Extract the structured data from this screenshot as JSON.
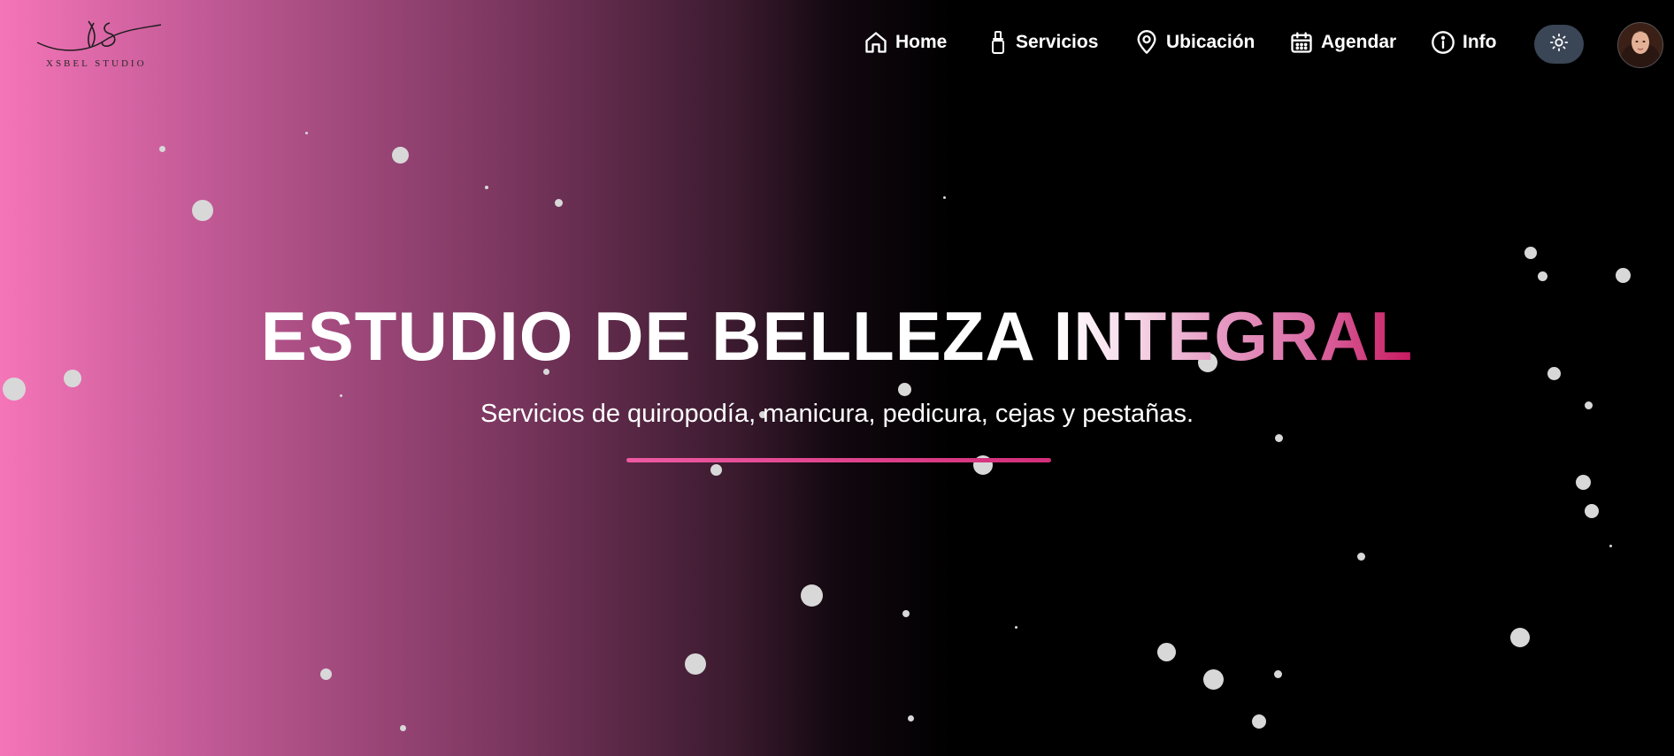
{
  "brand": {
    "logo_mark": "xs",
    "logo_text": "XSBEL STUDIO"
  },
  "nav": {
    "items": [
      {
        "label": "Home",
        "icon": "home-icon"
      },
      {
        "label": "Servicios",
        "icon": "nail-polish-icon"
      },
      {
        "label": "Ubicación",
        "icon": "map-pin-icon"
      },
      {
        "label": "Agendar",
        "icon": "calendar-icon"
      },
      {
        "label": "Info",
        "icon": "info-icon"
      }
    ],
    "theme_toggle_icon": "sun-icon",
    "avatar_icon": "user-avatar"
  },
  "hero": {
    "title_part1": "ESTUDIO DE BELLEZA",
    "title_part2": "INTEGRAL",
    "subtitle": "Servicios de quiropodía, manicura, pedicura, cejas y pestañas."
  },
  "colors": {
    "accent_pink": "#f575b8",
    "accent_magenta": "#c8195f",
    "toggle_bg": "#3a4556",
    "background": "#000000"
  }
}
